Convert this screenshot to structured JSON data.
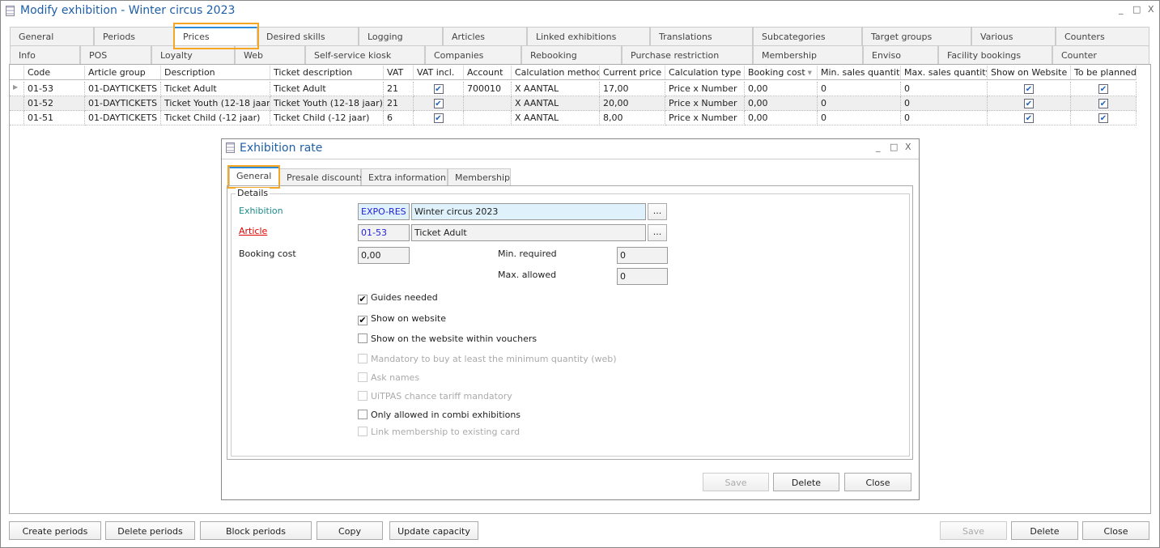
{
  "window": {
    "title": "Modify exhibition - Winter circus 2023",
    "minimize": "_",
    "maximize": "□",
    "close": "X"
  },
  "tabs_row1": [
    "General",
    "Periods",
    "Prices",
    "Desired skills",
    "Logging",
    "Articles",
    "Linked exhibitions",
    "Translations",
    "Subcategories",
    "Target groups",
    "Various",
    "Counters"
  ],
  "tabs_row2": [
    "Info",
    "POS",
    "Loyalty",
    "Web",
    "Self-service kiosk",
    "Companies",
    "Rebooking",
    "Purchase restriction",
    "Membership",
    "Enviso",
    "Facility bookings",
    "Counter"
  ],
  "active_tab": "Prices",
  "grid": {
    "columns": [
      "Code",
      "Article group",
      "Description",
      "Ticket description",
      "VAT",
      "VAT incl.",
      "Account",
      "Calculation method",
      "Current price",
      "Calculation type",
      "Booking cost",
      "Min. sales quantity",
      "Max. sales quantity",
      "Show on Website",
      "To be planned"
    ],
    "rows": [
      [
        "01-53",
        "01-DAYTICKETS",
        "Ticket Adult",
        "Ticket Adult",
        "21",
        true,
        "700010",
        "X AANTAL",
        "17,00",
        "Price x Number",
        "0,00",
        "0",
        "0",
        true,
        true
      ],
      [
        "01-52",
        "01-DAYTICKETS",
        "Ticket Youth (12-18 jaar)",
        "Ticket Youth (12-18 jaar)",
        "21",
        true,
        "",
        "X AANTAL",
        "20,00",
        "Price x Number",
        "0,00",
        "0",
        "0",
        true,
        true
      ],
      [
        "01-51",
        "01-DAYTICKETS",
        "Ticket Child (-12 jaar)",
        "Ticket Child (-12 jaar)",
        "6",
        true,
        "",
        "X AANTAL",
        "8,00",
        "Price x Number",
        "0,00",
        "0",
        "0",
        true,
        true
      ]
    ]
  },
  "dialog": {
    "title": "Exhibition rate",
    "tabs": [
      "General",
      "Presale discounts",
      "Extra information",
      "Membership"
    ],
    "active_tab": "General",
    "group": "Details",
    "exhibition_label": "Exhibition",
    "exhibition_code": "EXPO-RES",
    "exhibition_name": "Winter circus 2023",
    "article_label": "Article",
    "article_code": "01-53",
    "article_name": "Ticket Adult",
    "browse": "...",
    "booking_cost_label": "Booking cost",
    "booking_cost": "0,00",
    "min_required_label": "Min. required",
    "min_required": "0",
    "max_allowed_label": "Max. allowed",
    "max_allowed": "0",
    "checks": [
      {
        "label": "Guides needed",
        "checked": true,
        "enabled": true
      },
      {
        "label": "Show on website",
        "checked": true,
        "enabled": true
      },
      {
        "label": "Show on the website within vouchers",
        "checked": false,
        "enabled": true
      },
      {
        "label": "Mandatory to buy at least the minimum quantity (web)",
        "checked": false,
        "enabled": false
      },
      {
        "label": "Ask names",
        "checked": false,
        "enabled": false
      },
      {
        "label": "UiTPAS chance tariff mandatory",
        "checked": false,
        "enabled": false
      },
      {
        "label": "Only allowed in combi exhibitions",
        "checked": false,
        "enabled": true
      },
      {
        "label": "Link membership to existing card",
        "checked": false,
        "enabled": false
      }
    ],
    "save": "Save",
    "delete": "Delete",
    "close": "Close"
  },
  "footer": {
    "create_periods": "Create periods",
    "delete_periods": "Delete periods",
    "block_periods": "Block periods",
    "copy": "Copy",
    "update_capacity": "Update capacity",
    "save": "Save",
    "delete": "Delete",
    "close": "Close"
  },
  "colors": {
    "accent": "#2d8ad6",
    "highlight": "#f5a623",
    "title": "#1e5fa8",
    "required": "#e00000",
    "exhibition_label": "#1a8a8a"
  }
}
